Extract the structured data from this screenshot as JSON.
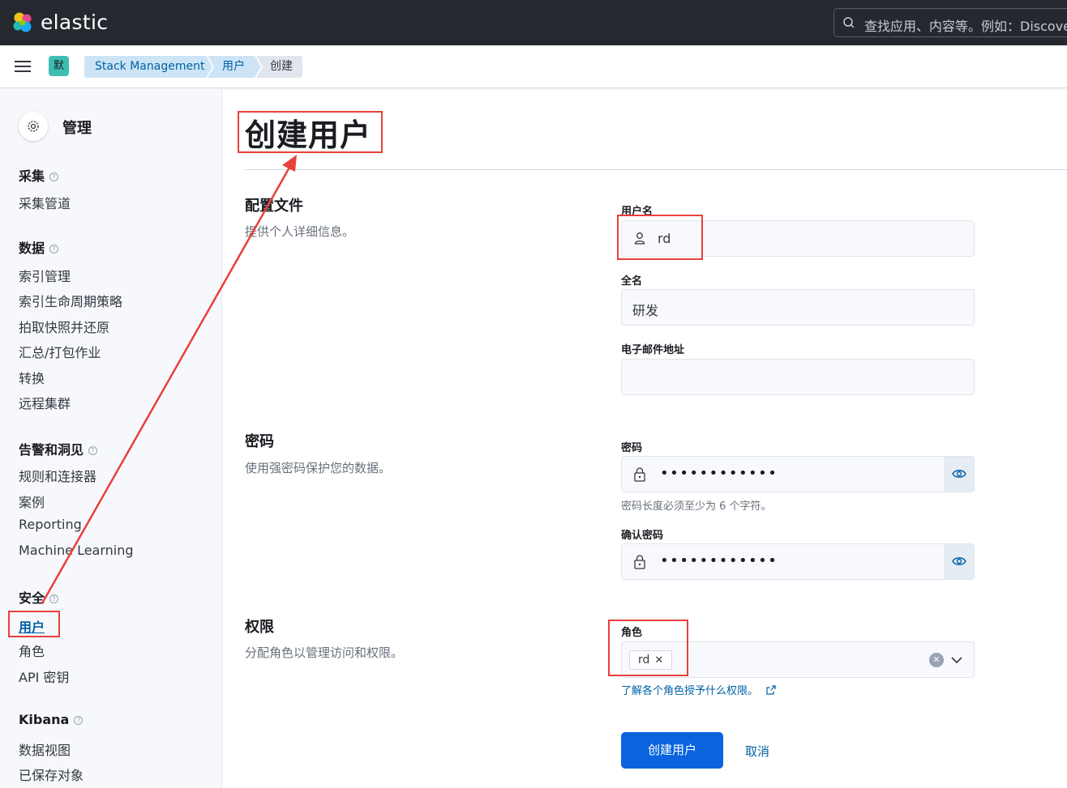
{
  "header": {
    "brand": "elastic",
    "search_placeholder": "查找应用、内容等。例如：Discover"
  },
  "breadcrumbs": {
    "space_badge": "默",
    "items": [
      "Stack Management",
      "用户",
      "创建"
    ]
  },
  "sidebar": {
    "title": "管理",
    "groups": [
      {
        "label": "采集",
        "items": [
          "采集管道"
        ]
      },
      {
        "label": "数据",
        "items": [
          "索引管理",
          "索引生命周期策略",
          "拍取快照并还原",
          "汇总/打包作业",
          "转换",
          "远程集群"
        ]
      },
      {
        "label": "告警和洞见",
        "items": [
          "规则和连接器",
          "案例",
          "Reporting",
          "Machine Learning"
        ]
      },
      {
        "label": "安全",
        "items": [
          "用户",
          "角色",
          "API 密钥"
        ]
      },
      {
        "label": "Kibana",
        "items": [
          "数据视图",
          "已保存对象"
        ]
      }
    ],
    "active_item": "用户"
  },
  "main": {
    "title": "创建用户",
    "profile": {
      "title": "配置文件",
      "desc": "提供个人详细信息。",
      "username_label": "用户名",
      "username_value": "rd",
      "fullname_label": "全名",
      "fullname_value": "研发",
      "email_label": "电子邮件地址",
      "email_value": ""
    },
    "password": {
      "title": "密码",
      "desc": "使用强密码保护您的数据。",
      "password_label": "密码",
      "password_value": "••••••••••••",
      "hint": "密码长度必须至少为 6 个字符。",
      "confirm_label": "确认密码",
      "confirm_value": "••••••••••••"
    },
    "privileges": {
      "title": "权限",
      "desc": "分配角色以管理访问和权限。",
      "roles_label": "角色",
      "roles": [
        "rd"
      ],
      "learn_link": "了解各个角色授予什么权限。"
    },
    "buttons": {
      "create": "创建用户",
      "cancel": "取消"
    }
  },
  "colors": {
    "header_bg": "#25282f",
    "primary": "#0b64dd",
    "link": "#0061a6",
    "annotation": "#e8403a"
  }
}
